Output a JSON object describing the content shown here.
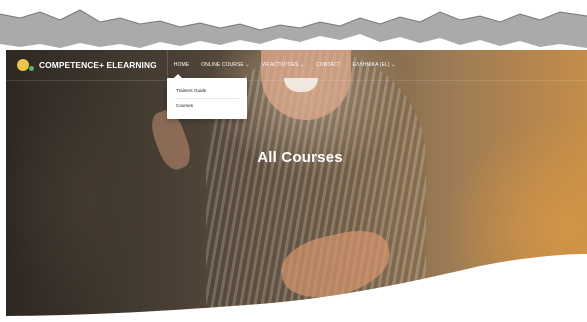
{
  "brand": {
    "name": "COMPETENCE+ ELEARNING",
    "logo_icon": "competence-logo-icon"
  },
  "nav": {
    "items": [
      {
        "label": "HOME"
      },
      {
        "label": "ONLINE COURSE ⌄"
      },
      {
        "label": "VR ACTIVITIES ⌄"
      },
      {
        "label": "CONTACT"
      },
      {
        "label": "ΕΛΛΗΝΙΚΑ (EL) ⌄"
      }
    ]
  },
  "dropdown": {
    "items": [
      {
        "label": "Trainers Guide"
      },
      {
        "label": "Courses"
      }
    ]
  },
  "hero": {
    "title": "All Courses"
  },
  "colors": {
    "accent_orange": "#c48d48",
    "logo_yellow": "#e7c44a",
    "logo_green": "#5bb36b",
    "text_white": "#ffffff"
  }
}
